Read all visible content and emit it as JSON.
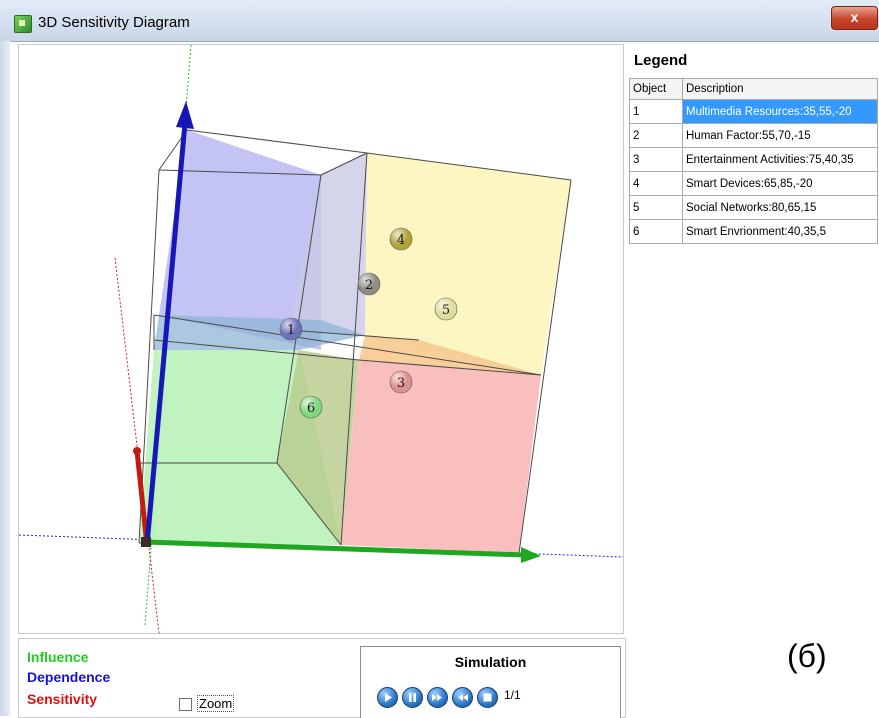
{
  "window": {
    "title": "3D Sensitivity Diagram",
    "close_glyph": "x"
  },
  "legend": {
    "title": "Legend",
    "columns": [
      "Object",
      "Description"
    ],
    "rows": [
      {
        "object": "1",
        "description": "Multimedia Resources:35,55,-20",
        "selected": true
      },
      {
        "object": "2",
        "description": "Human Factor:55,70,-15"
      },
      {
        "object": "3",
        "description": "Entertainment Activities:75,40,35"
      },
      {
        "object": "4",
        "description": "Smart Devices:65,85,-20"
      },
      {
        "object": "5",
        "description": "Social Networks:80,65,15"
      },
      {
        "object": "6",
        "description": "Smart Envrionment:40,35,5"
      }
    ]
  },
  "axes": {
    "influence": {
      "label": "Influence",
      "color": "#22cc22"
    },
    "dependence": {
      "label": "Dependence",
      "color": "#1515c8"
    },
    "sensitivity": {
      "label": "Sensitivity",
      "color": "#dd1111"
    }
  },
  "viewport": {
    "markers": [
      {
        "label": "1",
        "color": "#6f72b8"
      },
      {
        "label": "2",
        "color": "#8e8c83"
      },
      {
        "label": "3",
        "color": "#e08f8f"
      },
      {
        "label": "4",
        "color": "#b2a43a"
      },
      {
        "label": "5",
        "color": "#dedd9c"
      },
      {
        "label": "6",
        "color": "#7fd97f"
      }
    ],
    "regions": {
      "top_left": "#b9b9f2",
      "top_right": "#fbf5bb",
      "bottom_left": "#b9f2b9",
      "bottom_right": "#f9bcbc",
      "middle_band": "#8fb5d6",
      "orange_band": "#f7c58a"
    }
  },
  "controls": {
    "zoom_label": "Zoom",
    "zoom_checked": false,
    "simulation_title": "Simulation",
    "buttons": [
      "play-icon",
      "pause-icon",
      "fast-forward-icon",
      "rewind-icon",
      "stop-icon"
    ],
    "frame": "1/1"
  },
  "figure_label": "(б)"
}
